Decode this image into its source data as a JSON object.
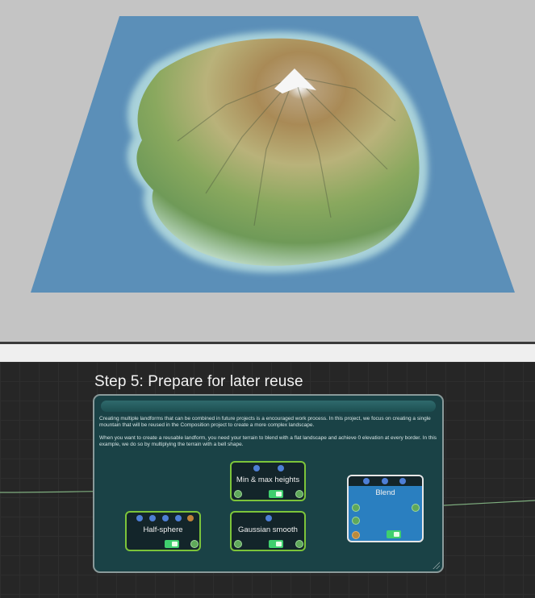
{
  "step": {
    "title": "Step 5: Prepare for later reuse",
    "description_1": "Creating multiple landforms that can be combined in future projects is a encouraged work process. In this project, we focus on creating a single mountain that will be reused in the Composition project to create a more complex landscape.",
    "description_2": "When you want to create a reusable landform, you need your terrain to blend with a flat landscape and achieve 0 elevation at every border. In this example, we do so by multiplying the terrain with a bell shape."
  },
  "nodes": {
    "min_max": {
      "label": "Min & max heights",
      "enabled": true
    },
    "half_sphere": {
      "label": "Half-sphere",
      "enabled": true
    },
    "gaussian": {
      "label": "Gaussian smooth",
      "enabled": true
    },
    "blend": {
      "label": "Blend",
      "enabled": true
    }
  },
  "colors": {
    "node_border": "#7cc43a",
    "blend_fill": "#2a7fc0",
    "panel_fill": "#1a4246",
    "wire": "#7fae7f"
  }
}
